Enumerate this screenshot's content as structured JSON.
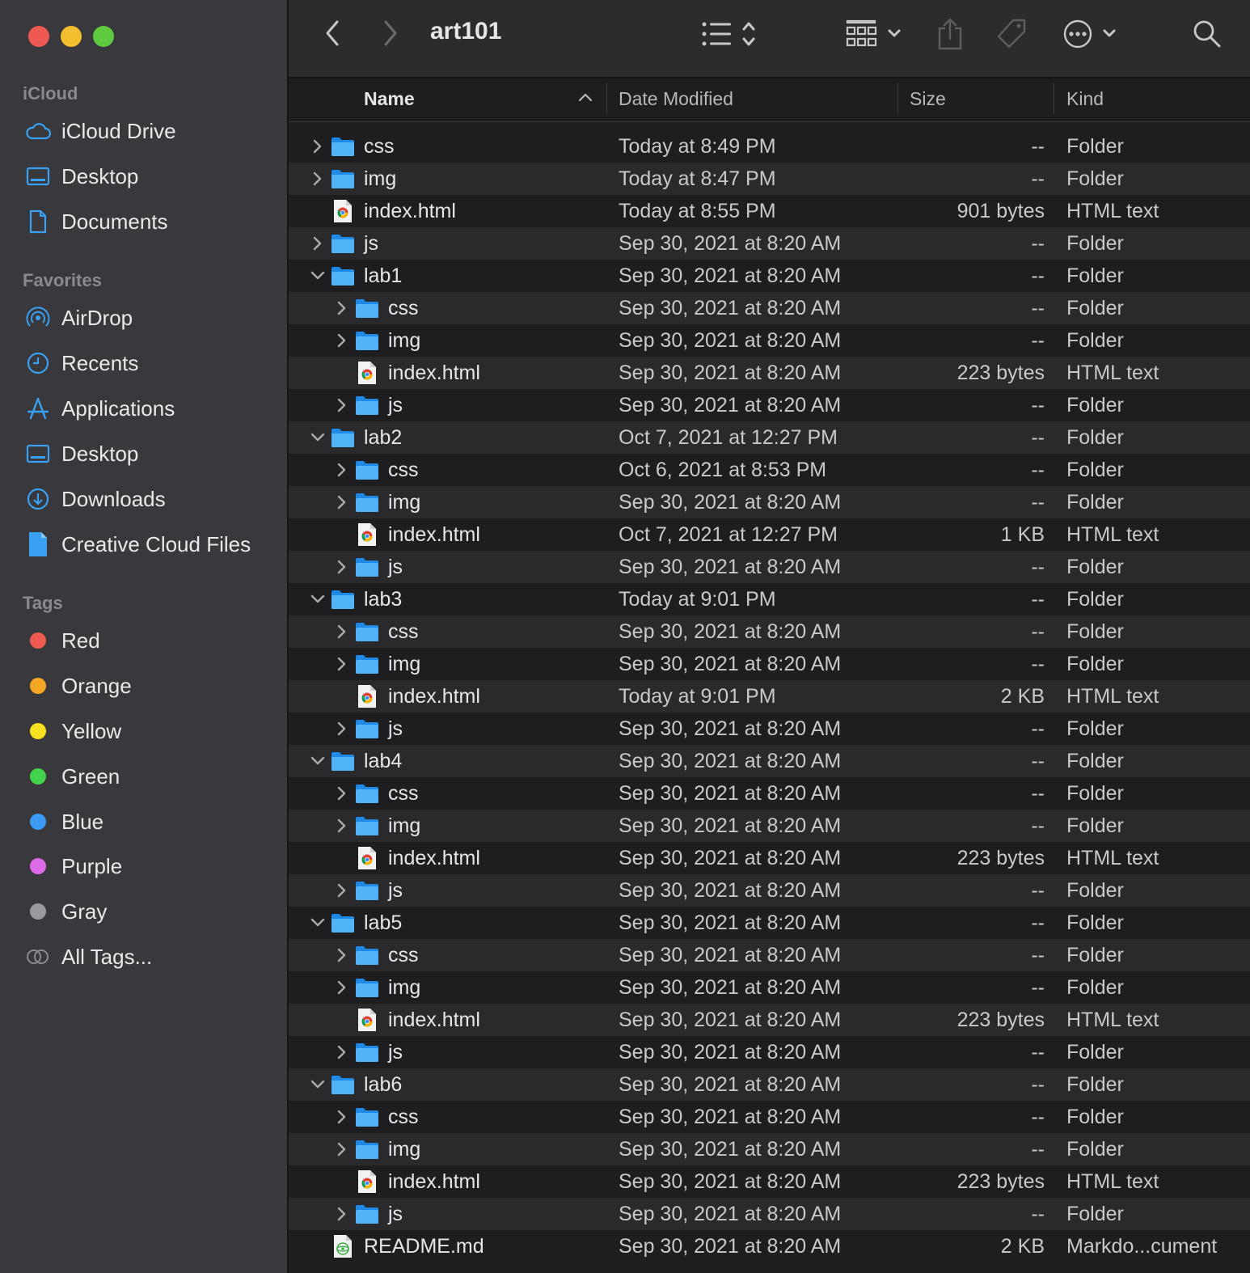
{
  "window": {
    "title": "art101"
  },
  "sidebar": {
    "sections": [
      {
        "label": "iCloud",
        "items": [
          {
            "label": "iCloud Drive",
            "icon": "cloud-icon"
          },
          {
            "label": "Desktop",
            "icon": "desktop-icon"
          },
          {
            "label": "Documents",
            "icon": "document-icon"
          }
        ]
      },
      {
        "label": "Favorites",
        "items": [
          {
            "label": "AirDrop",
            "icon": "airdrop-icon"
          },
          {
            "label": "Recents",
            "icon": "clock-icon"
          },
          {
            "label": "Applications",
            "icon": "applications-icon"
          },
          {
            "label": "Desktop",
            "icon": "desktop-icon"
          },
          {
            "label": "Downloads",
            "icon": "download-icon"
          },
          {
            "label": "Creative Cloud Files",
            "icon": "creative-cloud-file-icon"
          }
        ]
      },
      {
        "label": "Tags",
        "items": [
          {
            "label": "Red",
            "color": "#ee5a52"
          },
          {
            "label": "Orange",
            "color": "#f5a623"
          },
          {
            "label": "Yellow",
            "color": "#f7e01e"
          },
          {
            "label": "Green",
            "color": "#45d24c"
          },
          {
            "label": "Blue",
            "color": "#3c9cf5"
          },
          {
            "label": "Purple",
            "color": "#dd6ae6"
          },
          {
            "label": "Gray",
            "color": "#9a9a9e"
          },
          {
            "label": "All Tags...",
            "icon": "all-tags-icon"
          }
        ]
      }
    ]
  },
  "toolbar": {
    "back_icon": "chevron-left-icon",
    "forward_icon": "chevron-right-icon",
    "list_view_icon": "list-view-icon",
    "group_icon": "grid-group-icon",
    "share_icon": "share-icon",
    "tag_icon": "tag-icon",
    "more_icon": "more-actions-icon",
    "search_icon": "search-icon"
  },
  "columns": {
    "name": "Name",
    "date": "Date Modified",
    "size": "Size",
    "kind": "Kind"
  },
  "colors": {
    "accent": "#3aa0f2",
    "sidebar_bg": "#38383d",
    "row_alt": "#2a2a2d"
  },
  "files": [
    {
      "name": "css",
      "date": "Today at 8:49 PM",
      "size": "--",
      "kind": "Folder",
      "type": "folder",
      "level": 0,
      "expanded": false
    },
    {
      "name": "img",
      "date": "Today at 8:47 PM",
      "size": "--",
      "kind": "Folder",
      "type": "folder",
      "level": 0,
      "expanded": false
    },
    {
      "name": "index.html",
      "date": "Today at 8:55 PM",
      "size": "901 bytes",
      "kind": "HTML text",
      "type": "html",
      "level": 0
    },
    {
      "name": "js",
      "date": "Sep 30, 2021 at 8:20 AM",
      "size": "--",
      "kind": "Folder",
      "type": "folder",
      "level": 0,
      "expanded": false
    },
    {
      "name": "lab1",
      "date": "Sep 30, 2021 at 8:20 AM",
      "size": "--",
      "kind": "Folder",
      "type": "folder",
      "level": 0,
      "expanded": true
    },
    {
      "name": "css",
      "date": "Sep 30, 2021 at 8:20 AM",
      "size": "--",
      "kind": "Folder",
      "type": "folder",
      "level": 1,
      "expanded": false
    },
    {
      "name": "img",
      "date": "Sep 30, 2021 at 8:20 AM",
      "size": "--",
      "kind": "Folder",
      "type": "folder",
      "level": 1,
      "expanded": false
    },
    {
      "name": "index.html",
      "date": "Sep 30, 2021 at 8:20 AM",
      "size": "223 bytes",
      "kind": "HTML text",
      "type": "html",
      "level": 1
    },
    {
      "name": "js",
      "date": "Sep 30, 2021 at 8:20 AM",
      "size": "--",
      "kind": "Folder",
      "type": "folder",
      "level": 1,
      "expanded": false
    },
    {
      "name": "lab2",
      "date": "Oct 7, 2021 at 12:27 PM",
      "size": "--",
      "kind": "Folder",
      "type": "folder",
      "level": 0,
      "expanded": true
    },
    {
      "name": "css",
      "date": "Oct 6, 2021 at 8:53 PM",
      "size": "--",
      "kind": "Folder",
      "type": "folder",
      "level": 1,
      "expanded": false
    },
    {
      "name": "img",
      "date": "Sep 30, 2021 at 8:20 AM",
      "size": "--",
      "kind": "Folder",
      "type": "folder",
      "level": 1,
      "expanded": false
    },
    {
      "name": "index.html",
      "date": "Oct 7, 2021 at 12:27 PM",
      "size": "1 KB",
      "kind": "HTML text",
      "type": "html",
      "level": 1
    },
    {
      "name": "js",
      "date": "Sep 30, 2021 at 8:20 AM",
      "size": "--",
      "kind": "Folder",
      "type": "folder",
      "level": 1,
      "expanded": false
    },
    {
      "name": "lab3",
      "date": "Today at 9:01 PM",
      "size": "--",
      "kind": "Folder",
      "type": "folder",
      "level": 0,
      "expanded": true
    },
    {
      "name": "css",
      "date": "Sep 30, 2021 at 8:20 AM",
      "size": "--",
      "kind": "Folder",
      "type": "folder",
      "level": 1,
      "expanded": false
    },
    {
      "name": "img",
      "date": "Sep 30, 2021 at 8:20 AM",
      "size": "--",
      "kind": "Folder",
      "type": "folder",
      "level": 1,
      "expanded": false
    },
    {
      "name": "index.html",
      "date": "Today at 9:01 PM",
      "size": "2 KB",
      "kind": "HTML text",
      "type": "html",
      "level": 1
    },
    {
      "name": "js",
      "date": "Sep 30, 2021 at 8:20 AM",
      "size": "--",
      "kind": "Folder",
      "type": "folder",
      "level": 1,
      "expanded": false
    },
    {
      "name": "lab4",
      "date": "Sep 30, 2021 at 8:20 AM",
      "size": "--",
      "kind": "Folder",
      "type": "folder",
      "level": 0,
      "expanded": true
    },
    {
      "name": "css",
      "date": "Sep 30, 2021 at 8:20 AM",
      "size": "--",
      "kind": "Folder",
      "type": "folder",
      "level": 1,
      "expanded": false
    },
    {
      "name": "img",
      "date": "Sep 30, 2021 at 8:20 AM",
      "size": "--",
      "kind": "Folder",
      "type": "folder",
      "level": 1,
      "expanded": false
    },
    {
      "name": "index.html",
      "date": "Sep 30, 2021 at 8:20 AM",
      "size": "223 bytes",
      "kind": "HTML text",
      "type": "html",
      "level": 1
    },
    {
      "name": "js",
      "date": "Sep 30, 2021 at 8:20 AM",
      "size": "--",
      "kind": "Folder",
      "type": "folder",
      "level": 1,
      "expanded": false
    },
    {
      "name": "lab5",
      "date": "Sep 30, 2021 at 8:20 AM",
      "size": "--",
      "kind": "Folder",
      "type": "folder",
      "level": 0,
      "expanded": true
    },
    {
      "name": "css",
      "date": "Sep 30, 2021 at 8:20 AM",
      "size": "--",
      "kind": "Folder",
      "type": "folder",
      "level": 1,
      "expanded": false
    },
    {
      "name": "img",
      "date": "Sep 30, 2021 at 8:20 AM",
      "size": "--",
      "kind": "Folder",
      "type": "folder",
      "level": 1,
      "expanded": false
    },
    {
      "name": "index.html",
      "date": "Sep 30, 2021 at 8:20 AM",
      "size": "223 bytes",
      "kind": "HTML text",
      "type": "html",
      "level": 1
    },
    {
      "name": "js",
      "date": "Sep 30, 2021 at 8:20 AM",
      "size": "--",
      "kind": "Folder",
      "type": "folder",
      "level": 1,
      "expanded": false
    },
    {
      "name": "lab6",
      "date": "Sep 30, 2021 at 8:20 AM",
      "size": "--",
      "kind": "Folder",
      "type": "folder",
      "level": 0,
      "expanded": true
    },
    {
      "name": "css",
      "date": "Sep 30, 2021 at 8:20 AM",
      "size": "--",
      "kind": "Folder",
      "type": "folder",
      "level": 1,
      "expanded": false
    },
    {
      "name": "img",
      "date": "Sep 30, 2021 at 8:20 AM",
      "size": "--",
      "kind": "Folder",
      "type": "folder",
      "level": 1,
      "expanded": false
    },
    {
      "name": "index.html",
      "date": "Sep 30, 2021 at 8:20 AM",
      "size": "223 bytes",
      "kind": "HTML text",
      "type": "html",
      "level": 1
    },
    {
      "name": "js",
      "date": "Sep 30, 2021 at 8:20 AM",
      "size": "--",
      "kind": "Folder",
      "type": "folder",
      "level": 1,
      "expanded": false
    },
    {
      "name": "README.md",
      "date": "Sep 30, 2021 at 8:20 AM",
      "size": "2 KB",
      "kind": "Markdo...cument",
      "type": "markdown",
      "level": 0
    }
  ]
}
